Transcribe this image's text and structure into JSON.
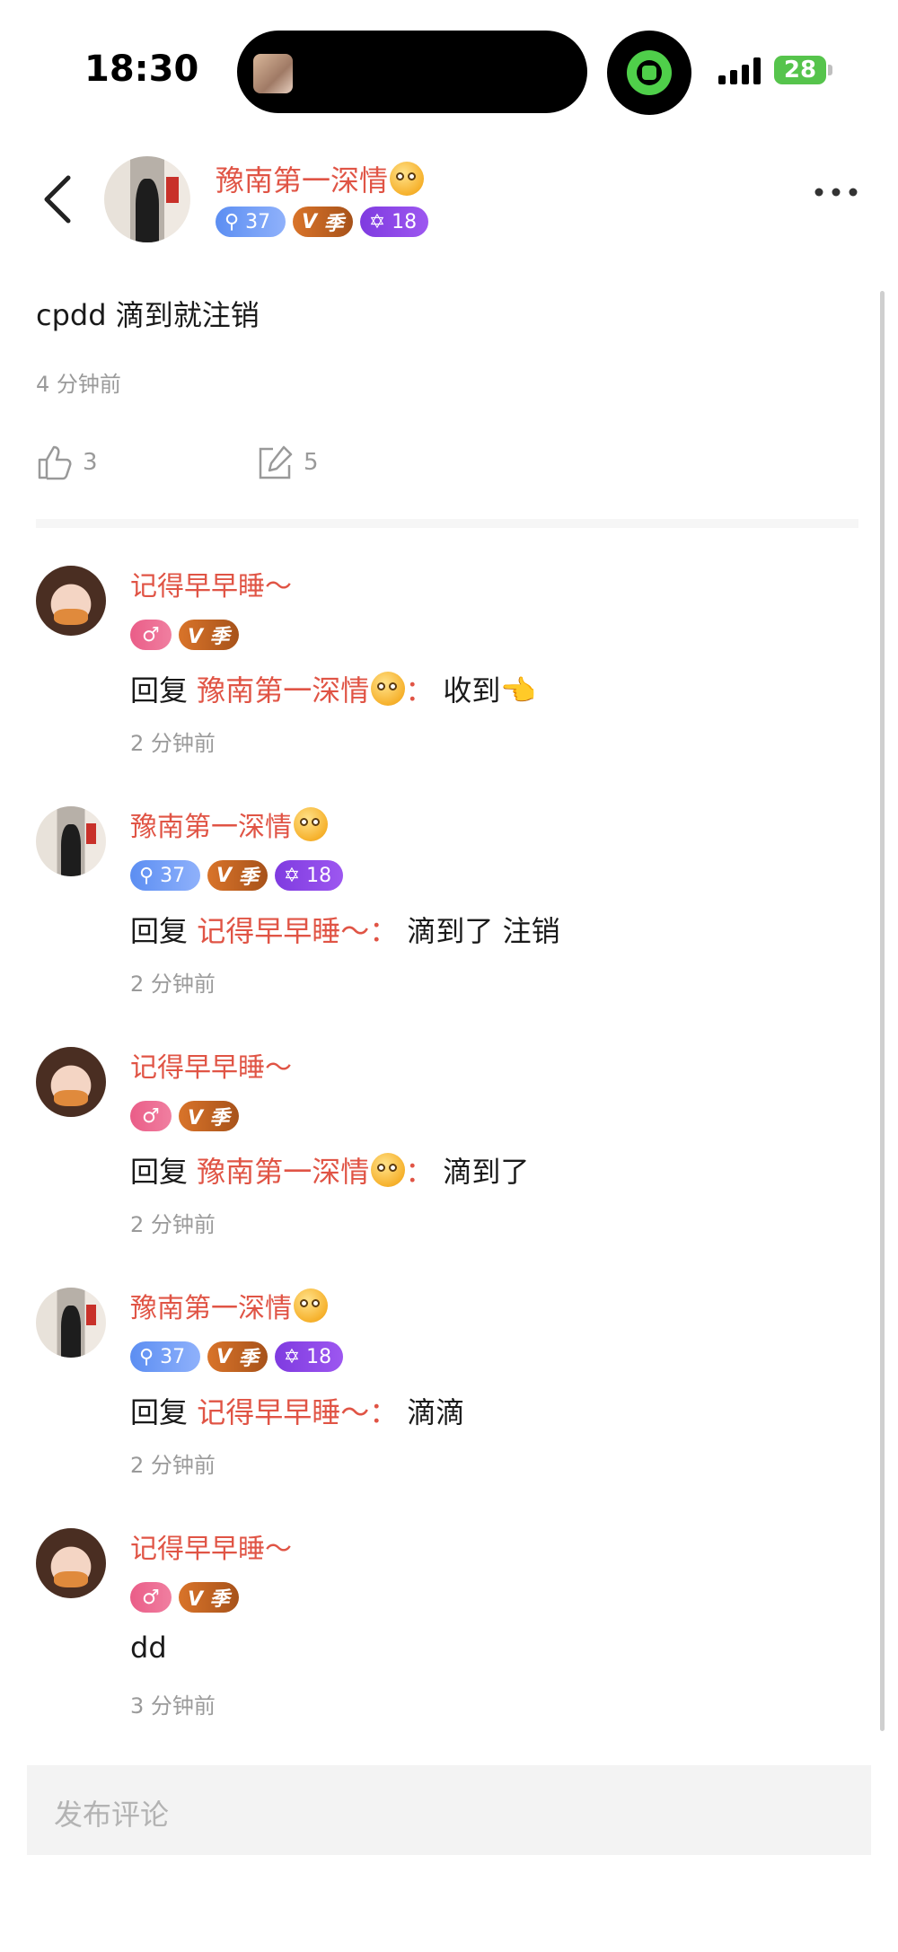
{
  "status_bar": {
    "time": "18:30",
    "battery": "28"
  },
  "post": {
    "author": "豫南第一深情",
    "badges": {
      "level": "37",
      "vip_label": "季",
      "rank": "18"
    },
    "text": "cpdd 滴到就注销",
    "time": "4 分钟前",
    "likes": "3",
    "comments": "5"
  },
  "comments": [
    {
      "name": "记得早早睡～",
      "reply_prefix": "回复",
      "reply_to": "豫南第一深情",
      "text": "收到",
      "time": "2 分钟前"
    },
    {
      "name": "豫南第一深情",
      "level": "37",
      "vip": "季",
      "rank": "18",
      "reply_prefix": "回复",
      "reply_to": "记得早早睡～",
      "text": "滴到了 注销",
      "time": "2 分钟前"
    },
    {
      "name": "记得早早睡～",
      "reply_prefix": "回复",
      "reply_to": "豫南第一深情",
      "text": "滴到了",
      "time": "2 分钟前"
    },
    {
      "name": "豫南第一深情",
      "level": "37",
      "vip": "季",
      "rank": "18",
      "reply_prefix": "回复",
      "reply_to": "记得早早睡～",
      "text": "滴滴",
      "time": "2 分钟前"
    },
    {
      "name": "记得早早睡～",
      "text": "dd",
      "time": "3 分钟前"
    }
  ],
  "input": {
    "placeholder": "发布评论"
  },
  "icons": [
    "back-icon",
    "more-icon",
    "like-icon",
    "comment-icon",
    "signal-icon",
    "battery-icon",
    "rolling-eyes-emoji",
    "pointing-emoji"
  ]
}
